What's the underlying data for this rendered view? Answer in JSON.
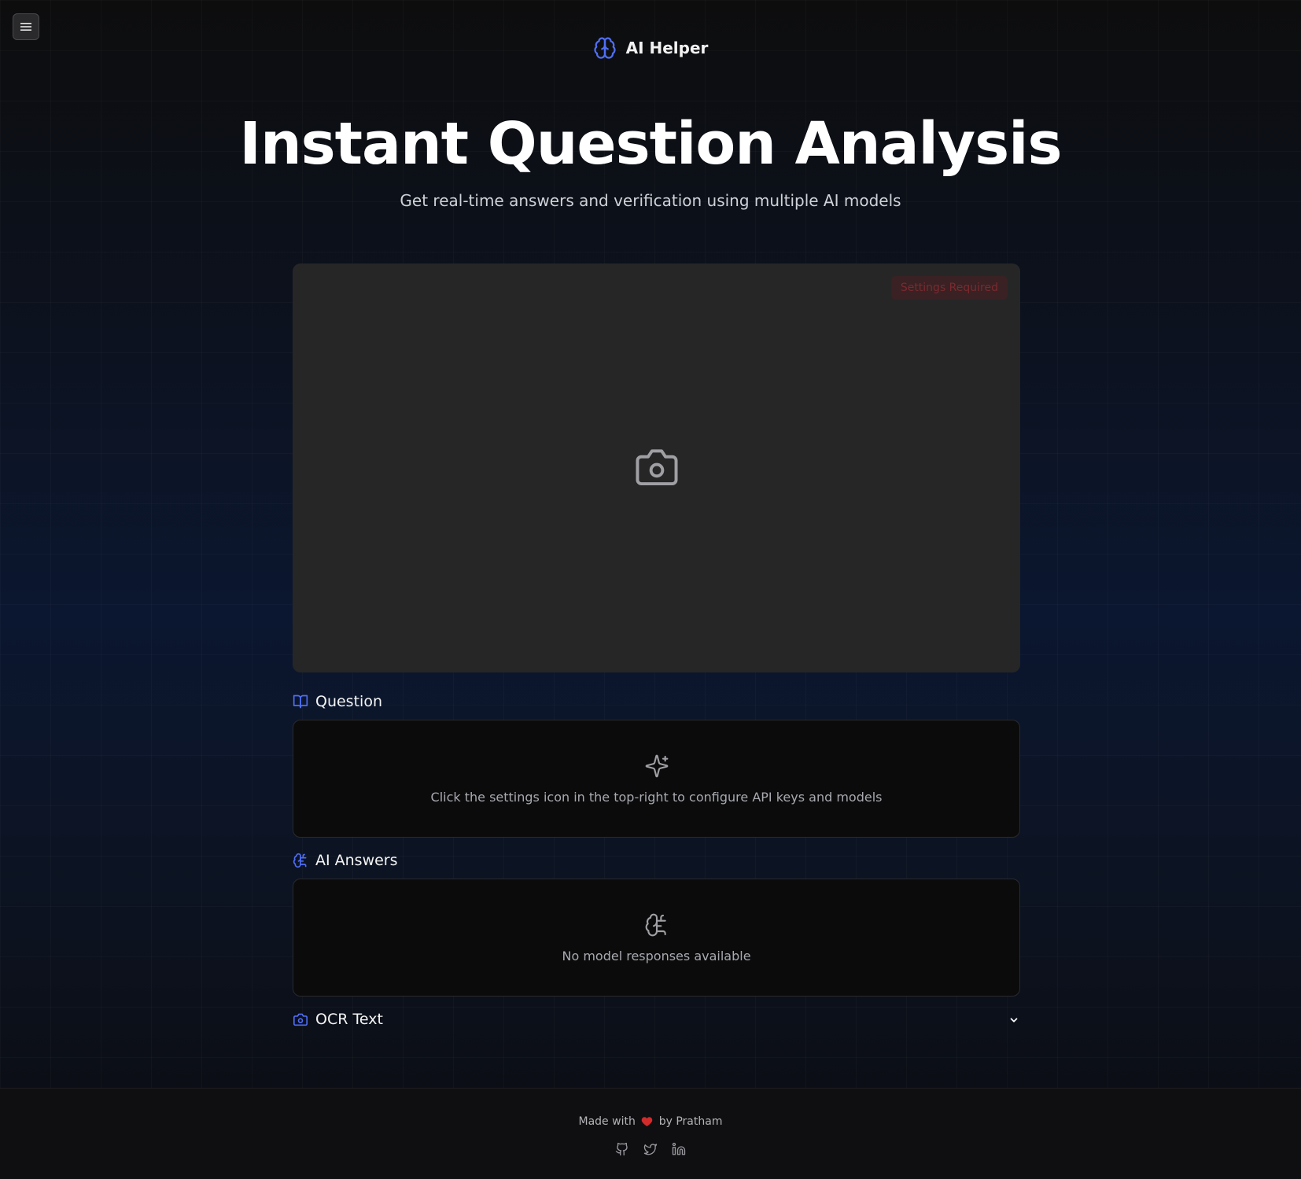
{
  "header": {
    "brand_name": "AI Helper",
    "brand_icon": "brain-icon",
    "menu_icon": "hamburger-menu-icon"
  },
  "hero": {
    "title": "Instant Question Analysis",
    "subtitle": "Get real-time answers and verification using multiple AI models"
  },
  "capture": {
    "badge": "Settings Required",
    "icon": "camera-icon"
  },
  "question": {
    "label": "Question",
    "icon": "book-open-icon",
    "empty_icon": "sparkles-icon",
    "empty_message": "Click the settings icon in the top-right to configure API keys and models"
  },
  "answers": {
    "label": "AI Answers",
    "icon": "brain-circuit-icon",
    "empty_message": "No model responses available"
  },
  "ocr": {
    "label": "OCR Text",
    "icon": "camera-icon",
    "toggle_icon": "chevron-down-icon"
  },
  "footer": {
    "made_with": "Made with",
    "by": "by Pratham",
    "links": [
      "github-icon",
      "twitter-icon",
      "linkedin-icon"
    ]
  },
  "colors": {
    "accent": "#4f6ef7",
    "badge_text": "#7a2a2f",
    "heart": "#d12b2b"
  }
}
